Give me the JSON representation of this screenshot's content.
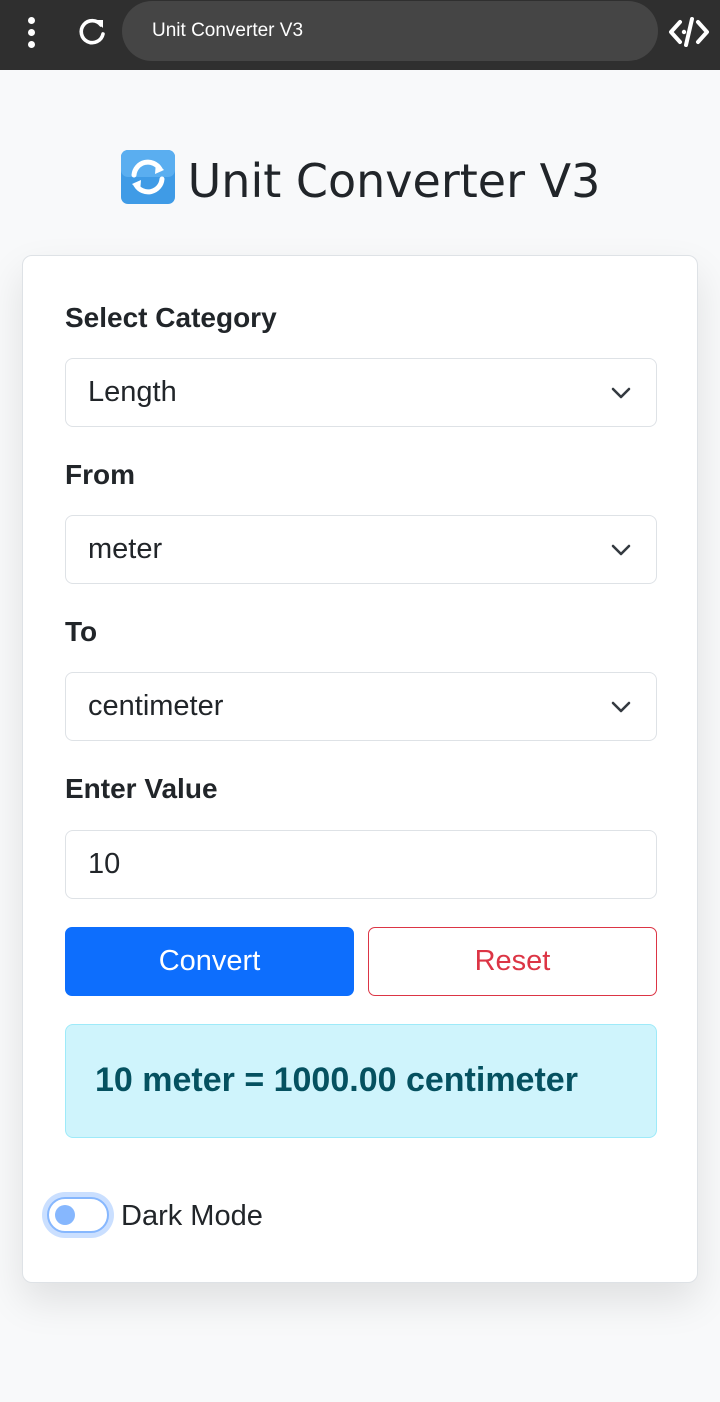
{
  "browser": {
    "menu_icon": "kebab-menu-icon",
    "reload_icon": "reload-icon",
    "address_text": "Unit Converter V3",
    "devtools_icon": "code-icon"
  },
  "header": {
    "icon": "arrows-rotate-emoji-icon",
    "title": "Unit Converter V3"
  },
  "form": {
    "category_label": "Select Category",
    "category_value": "Length",
    "from_label": "From",
    "from_value": "meter",
    "to_label": "To",
    "to_value": "centimeter",
    "value_label": "Enter Value",
    "value_input": "10",
    "convert_label": "Convert",
    "reset_label": "Reset"
  },
  "result": {
    "text": "10 meter = 1000.00 centimeter"
  },
  "settings": {
    "dark_mode_label": "Dark Mode",
    "dark_mode_on": false
  },
  "colors": {
    "primary": "#0d6efd",
    "danger": "#dc3545",
    "info_bg": "#cff4fc",
    "info_text": "#055160",
    "browser_bar": "#2f2f2f"
  }
}
